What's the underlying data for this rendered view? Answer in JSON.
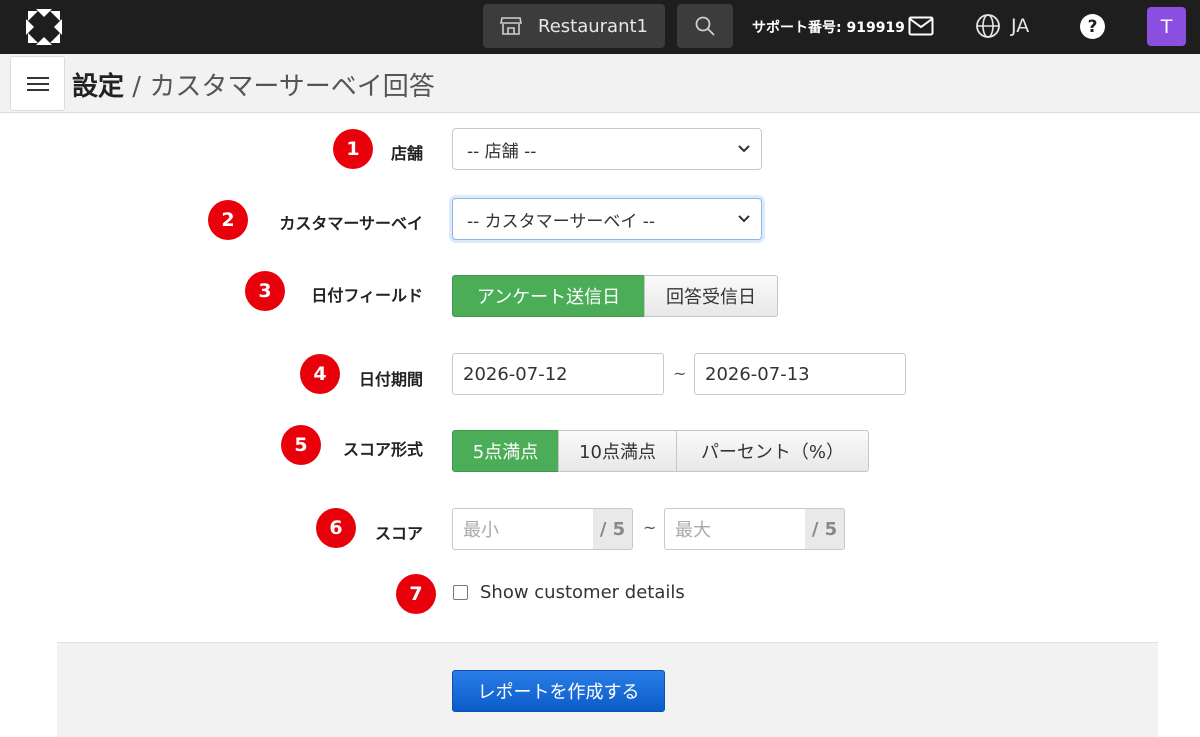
{
  "topbar": {
    "store_name": "Restaurant1",
    "support_text": "サポート番号: 919919",
    "language": "JA",
    "help_label": "?",
    "avatar_initial": "T"
  },
  "header": {
    "breadcrumb_root": "設定",
    "breadcrumb_separator": " / ",
    "breadcrumb_page": "カスタマーサーベイ回答"
  },
  "form": {
    "store": {
      "badge": "1",
      "label": "店舗",
      "value": "-- 店舗 --"
    },
    "survey": {
      "badge": "2",
      "label": "カスタマーサーベイ",
      "value": "-- カスタマーサーベイ --"
    },
    "date_field": {
      "badge": "3",
      "label": "日付フィールド",
      "options": [
        "アンケート送信日",
        "回答受信日"
      ],
      "selected": 0
    },
    "date_range": {
      "badge": "4",
      "label": "日付期間",
      "from": "2026-07-12",
      "to": "2026-07-13",
      "separator": "~"
    },
    "score_format": {
      "badge": "5",
      "label": "スコア形式",
      "options": [
        "5点満点",
        "10点満点",
        "パーセント（%）"
      ],
      "selected": 0
    },
    "score": {
      "badge": "6",
      "label": "スコア",
      "min_placeholder": "最小",
      "max_placeholder": "最大",
      "suffix": "/ 5",
      "separator": "~"
    },
    "customer_details": {
      "badge": "7",
      "label": "Show customer details",
      "checked": false
    },
    "submit_label": "レポートを作成する"
  },
  "colors": {
    "topbar_bg": "#1e1e1e",
    "badge_red": "#e8000b",
    "active_green": "#4cad58",
    "primary_blue": "#0b5cc9",
    "avatar_purple": "#8a4fe0"
  },
  "icons": {
    "logo": "brand-logo-icon",
    "store": "storefront-icon",
    "search": "search-icon",
    "mail": "mail-icon",
    "globe": "globe-icon",
    "help": "help-icon",
    "menu": "hamburger-menu-icon",
    "dropdown": "chevron-down-icon"
  }
}
